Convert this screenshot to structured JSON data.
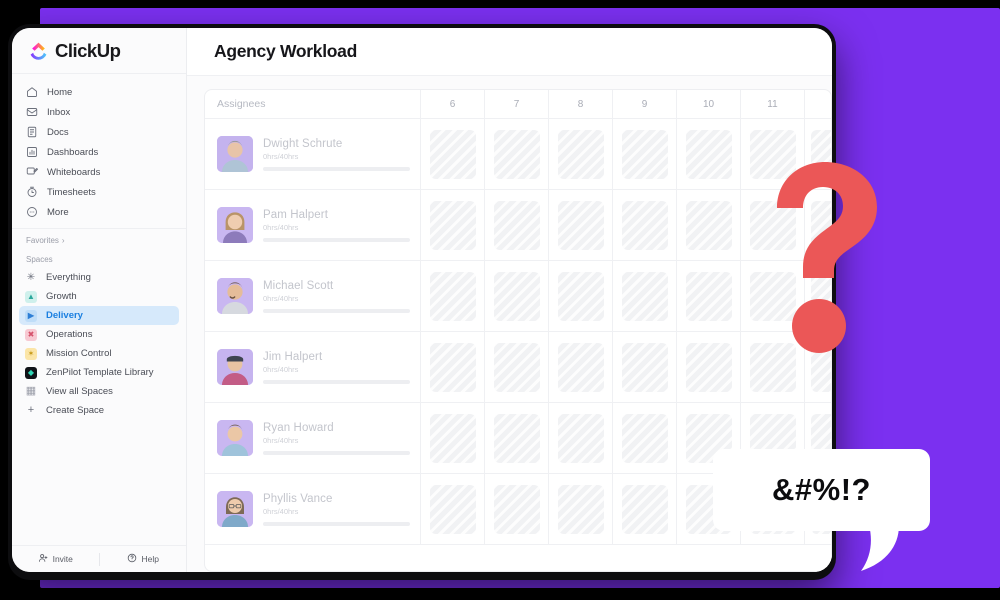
{
  "theme": {
    "backdrop_purple": "#7B30F0",
    "frame_black": "#0D0D0F",
    "accent_red": "#EB5757",
    "active_space_blue": "#1B7FE0",
    "active_space_bg": "#D6E9FB"
  },
  "brand": {
    "name": "ClickUp",
    "logo_icon": "clickup-logo-icon"
  },
  "sidebar": {
    "nav": [
      {
        "label": "Home",
        "icon": "home-icon"
      },
      {
        "label": "Inbox",
        "icon": "inbox-icon"
      },
      {
        "label": "Docs",
        "icon": "docs-icon"
      },
      {
        "label": "Dashboards",
        "icon": "dashboards-icon"
      },
      {
        "label": "Whiteboards",
        "icon": "whiteboards-icon"
      },
      {
        "label": "Timesheets",
        "icon": "timesheets-icon"
      },
      {
        "label": "More",
        "icon": "more-icon"
      }
    ],
    "favorites_label": "Favorites",
    "favorites_chevron": "›",
    "spaces_label": "Spaces",
    "spaces": [
      {
        "label": "Everything",
        "icon": "everything-icon",
        "color": "#6B6F7B",
        "bg": "transparent",
        "glyph": "✳",
        "active": false
      },
      {
        "label": "Growth",
        "icon": "growth-space-icon",
        "color": "#2AA79B",
        "bg": "#CFF0EC",
        "glyph": "↗",
        "active": false
      },
      {
        "label": "Delivery",
        "icon": "delivery-space-icon",
        "color": "#2E7FD6",
        "bg": "#BFDDF8",
        "glyph": "▶",
        "active": true
      },
      {
        "label": "Operations",
        "icon": "operations-space-icon",
        "color": "#D5526B",
        "bg": "#F7C9D2",
        "glyph": "✖",
        "active": false
      },
      {
        "label": "Mission Control",
        "icon": "mission-control-space-icon",
        "color": "#C79A18",
        "bg": "#FBE5A8",
        "glyph": "✦",
        "active": false
      },
      {
        "label": "ZenPilot Template Library",
        "icon": "zenpilot-space-icon",
        "color": "#2FD6B6",
        "bg": "#101318",
        "glyph": "◆",
        "active": false
      },
      {
        "label": "View all Spaces",
        "icon": "view-all-spaces-icon",
        "color": "#8A8D97",
        "bg": "transparent",
        "glyph": "▦",
        "active": false
      },
      {
        "label": "Create Space",
        "icon": "create-space-icon",
        "color": "#6B6F7B",
        "bg": "transparent",
        "glyph": "＋",
        "active": false
      }
    ],
    "footer": [
      {
        "label": "Invite",
        "icon": "invite-person-icon"
      },
      {
        "label": "Help",
        "icon": "help-question-icon"
      }
    ]
  },
  "main": {
    "page_title": "Agency Workload"
  },
  "workload": {
    "assignees_column_header": "Assignees",
    "day_columns": [
      "6",
      "7",
      "8",
      "9",
      "10",
      "11"
    ],
    "partial_column": "",
    "rows": [
      {
        "name": "Dwight Schrute",
        "hours": "0hrs/40hrs",
        "avatar_bg": "#C4B3EE",
        "skin": "#E8C4A8",
        "hair": "#9A9A9A",
        "shirt": "#AFC4D6"
      },
      {
        "name": "Pam Halpert",
        "hours": "0hrs/40hrs",
        "avatar_bg": "#C9B7F1",
        "skin": "#EFCDB0",
        "hair": "#B99467",
        "shirt": "#8D7BBB"
      },
      {
        "name": "Michael Scott",
        "hours": "0hrs/40hrs",
        "avatar_bg": "#C9B7F1",
        "skin": "#E5BC99",
        "hair": "#6A5243",
        "shirt": "#D6D9DF"
      },
      {
        "name": "Jim Halpert",
        "hours": "0hrs/40hrs",
        "avatar_bg": "#C6B4EF",
        "skin": "#E7C3A2",
        "hair": "#3E4450",
        "shirt": "#C35C86"
      },
      {
        "name": "Ryan Howard",
        "hours": "0hrs/40hrs",
        "avatar_bg": "#C9B7F1",
        "skin": "#EBC7A6",
        "hair": "#6E5A49",
        "shirt": "#9FC3DB"
      },
      {
        "name": "Phyllis Vance",
        "hours": "0hrs/40hrs",
        "avatar_bg": "#C9B7F1",
        "skin": "#EECBAC",
        "hair": "#7E6A57",
        "shirt": "#7FA9C9"
      }
    ]
  },
  "overlay": {
    "question_mark": "?",
    "speech_bubble_text": "&#%!?"
  }
}
